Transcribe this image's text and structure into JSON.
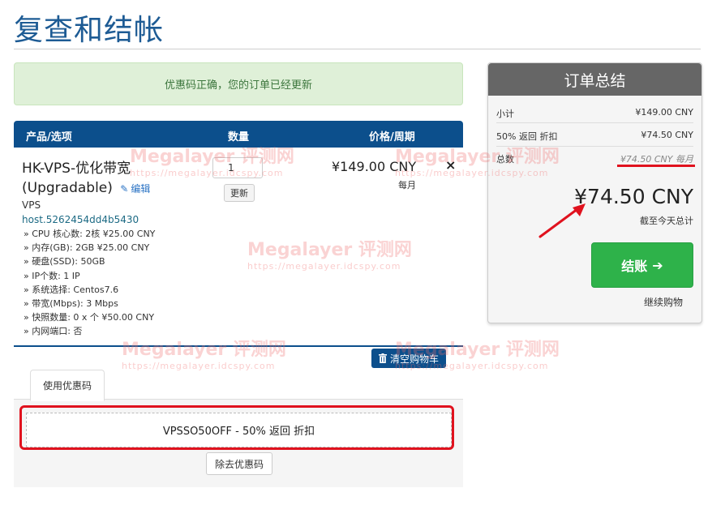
{
  "page": {
    "title": "复查和结帐"
  },
  "alert": {
    "message": "优惠码正确，您的订单已经更新"
  },
  "cart": {
    "headers": {
      "product": "产品/选项",
      "quantity": "数量",
      "price": "价格/周期"
    },
    "item": {
      "name": "HK-VPS-优化带宽 (Upgradable)",
      "edit_label": "编辑",
      "type": "VPS",
      "hostname": "host.5262454dd4b5430",
      "options": [
        "» CPU 核心数: 2核 ¥25.00 CNY",
        "» 内存(GB): 2GB ¥25.00 CNY",
        "» 硬盘(SSD): 50GB",
        "» IP个数: 1 IP",
        "» 系统选择: Centos7.6",
        "» 带宽(Mbps): 3 Mbps",
        "» 快照数量: 0 x 个 ¥50.00 CNY",
        "» 内网端口: 否"
      ],
      "quantity": "1",
      "update_label": "更新",
      "price": "¥149.00 CNY",
      "cycle": "每月",
      "remove_symbol": "×"
    },
    "empty_cart_label": "清空购物车"
  },
  "promo": {
    "tab_label": "使用优惠码",
    "applied_code": "VPSSO50OFF - 50% 返回 折扣",
    "remove_label": "除去优惠码"
  },
  "summary": {
    "header": "订单总结",
    "subtotal_label": "小计",
    "subtotal_value": "¥149.00 CNY",
    "discount_label": "50% 返回 折扣",
    "discount_value": "¥74.50 CNY",
    "totals_label": "总数",
    "totals_value": "¥74.50 CNY 每月",
    "total_due": "¥74.50 CNY",
    "due_today_label": "截至今天总计",
    "checkout_label": "结账",
    "continue_label": "继续购物"
  },
  "watermark": {
    "brand": "Megalayer 评测网",
    "url": "https://megalayer.idcspy.com"
  },
  "colors": {
    "brand_blue": "#0c4f8c",
    "checkout_green": "#2eb24a",
    "highlight_red": "#e0121e",
    "summary_header": "#666666"
  }
}
